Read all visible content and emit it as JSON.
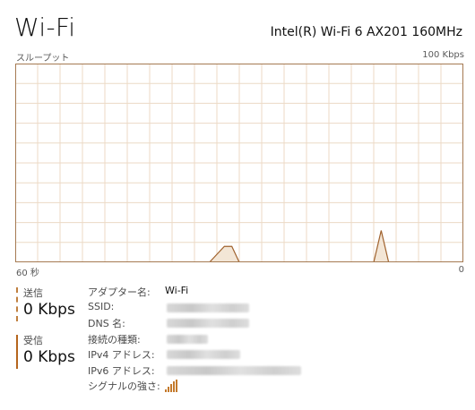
{
  "header": {
    "title": "Wi-Fi",
    "adapter_name": "Intel(R) Wi-Fi 6 AX201 160MHz"
  },
  "chart": {
    "top_left_label": "スループット",
    "top_right_label": "100 Kbps",
    "bottom_left_label": "60 秒",
    "bottom_right_label": "0",
    "line_color": "#a0622d",
    "fill_color": "#f3e6d6",
    "grid_color": "#ecdac6"
  },
  "chart_data": {
    "type": "area",
    "title": "",
    "xlabel": "",
    "ylabel": "",
    "x_range_seconds": [
      60,
      0
    ],
    "ylim_kbps": [
      0,
      100
    ],
    "grid": true,
    "series": [
      {
        "name": "受信",
        "x_seconds_ago": [
          60,
          34,
          33,
          32,
          31,
          30,
          20,
          12,
          11,
          10,
          0
        ],
        "y_kbps": [
          0,
          0,
          4,
          8,
          8,
          0,
          0,
          0,
          16,
          0,
          0
        ]
      }
    ]
  },
  "stats": {
    "send": {
      "label": "送信",
      "value": "0 Kbps",
      "color": "#c08040"
    },
    "receive": {
      "label": "受信",
      "value": "0 Kbps",
      "color": "#b5651d"
    }
  },
  "details": {
    "adapter_label": "アダプター名:",
    "adapter_value": "Wi-Fi",
    "ssid_label": "SSID:",
    "dns_label": "DNS 名:",
    "conn_type_label": "接続の種類:",
    "ipv4_label": "IPv4 アドレス:",
    "ipv6_label": "IPv6 アドレス:",
    "signal_label": "シグナルの強さ:",
    "signal_icon": "wifi-signal-bars-icon"
  }
}
